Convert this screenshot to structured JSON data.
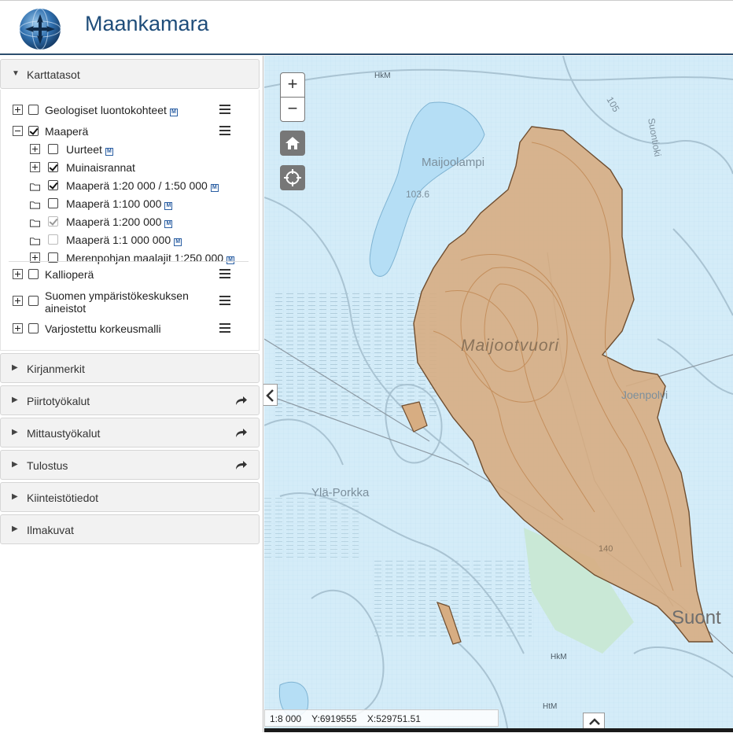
{
  "header": {
    "title": "Maankamara",
    "logo_icon": "compass-globe-icon"
  },
  "sidebar": {
    "layers_panel": {
      "title": "Karttatasot",
      "groups": [
        {
          "label": "Geologiset luontokohteet",
          "checked": false,
          "expanded": false,
          "meta": "M"
        },
        {
          "label": "Maaperä",
          "checked": true,
          "expanded": true,
          "children": [
            {
              "label": "Uurteet",
              "checked": false,
              "type": "expander",
              "meta": "M"
            },
            {
              "label": "Muinaisrannat",
              "checked": true,
              "type": "expander"
            },
            {
              "label": "Maaperä 1:20 000 / 1:50 000",
              "checked": true,
              "type": "folder",
              "meta": "M"
            },
            {
              "label": "Maaperä 1:100 000",
              "checked": false,
              "type": "folder",
              "meta": "M"
            },
            {
              "label": "Maaperä 1:200 000",
              "checked": true,
              "disabled": true,
              "type": "folder",
              "meta": "M"
            },
            {
              "label": "Maaperä 1:1 000 000",
              "checked": false,
              "disabled": true,
              "type": "folder",
              "meta": "M"
            },
            {
              "label": "Merenpohjan maalajit 1:250 000",
              "checked": false,
              "type": "expander",
              "meta": "M"
            }
          ]
        },
        {
          "label": "Kallioperä",
          "checked": false
        },
        {
          "label": "Suomen ympäristökeskuksen aineistot",
          "checked": false
        },
        {
          "label": "Varjostettu korkeusmalli",
          "checked": false
        }
      ]
    },
    "panels": [
      {
        "label": "Kirjanmerkit",
        "has_share": false
      },
      {
        "label": "Piirtotyökalut",
        "has_share": true
      },
      {
        "label": "Mittaustyökalut",
        "has_share": true
      },
      {
        "label": "Tulostus",
        "has_share": true
      },
      {
        "label": "Kiinteistötiedot",
        "has_share": false
      },
      {
        "label": "Ilmakuvat",
        "has_share": false
      }
    ]
  },
  "map": {
    "zoom_in": "+",
    "zoom_out": "−",
    "home_icon": "home-icon",
    "locate_icon": "locate-icon",
    "labels": {
      "lake": "Maijoolampi",
      "hill": "Maijootvuori",
      "village_west": "Ylä-Porkka",
      "village_east": "Joenpolvi",
      "town": "Suont",
      "river": "Suontioki",
      "elev1": "103.6",
      "elev2": "105",
      "elev3": "140",
      "hkm1": "HkM",
      "hkm2": "HkM",
      "htm": "HtM"
    },
    "colors": {
      "water": "#b9dff4",
      "land": "#d4ecf8",
      "soil_polygon": "#d6ad82",
      "soil_edge": "#7a5a3a"
    }
  },
  "status": {
    "scale": "1:8 000",
    "y": "Y:6919555",
    "x": "X:529751.51"
  }
}
